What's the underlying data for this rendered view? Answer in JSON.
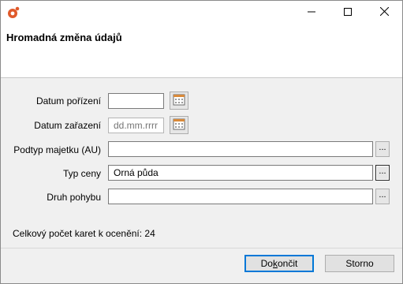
{
  "window": {
    "icon": "app-logo-icon",
    "controls": {
      "minimize": "minimize-icon",
      "maximize": "maximize-icon",
      "close": "close-icon"
    }
  },
  "dialog": {
    "title": "Hromadná změna údajů"
  },
  "form": {
    "datum_porizeni": {
      "label": "Datum pořízení",
      "value": "",
      "button_icon": "calendar-icon"
    },
    "datum_zarazeni": {
      "label": "Datum zařazení",
      "placeholder": "dd.mm.rrrr",
      "button_icon": "calendar-icon"
    },
    "podtyp_majetku": {
      "label": "Podtyp majetku (AU)",
      "value": "",
      "button_label": "..."
    },
    "typ_ceny": {
      "label": "Typ ceny",
      "value": "Orná půda",
      "button_label": "..."
    },
    "druh_pohybu": {
      "label": "Druh pohybu",
      "value": "",
      "button_label": "..."
    }
  },
  "status": {
    "count_text": "Celkový počet karet k ocenění: 24"
  },
  "buttons": {
    "finish": {
      "pre": "Do",
      "accel": "k",
      "post": "ončit"
    },
    "cancel": "Storno"
  }
}
